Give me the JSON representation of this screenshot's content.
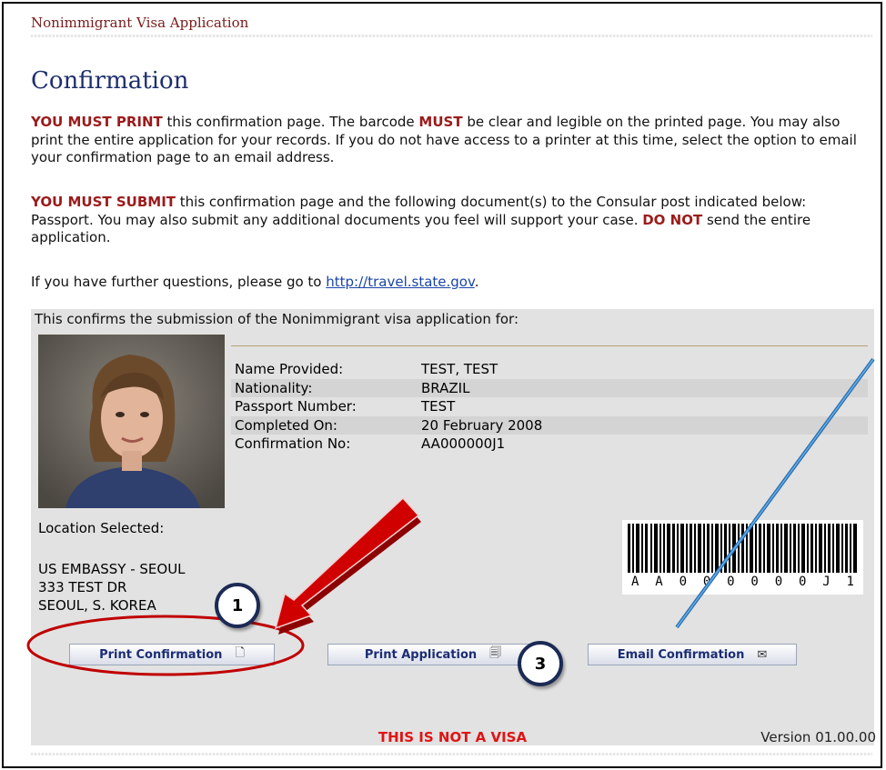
{
  "header": {
    "app_title": "Nonimmigrant Visa Application"
  },
  "page_title": "Confirmation",
  "instructions": {
    "p1": {
      "strong": "YOU MUST PRINT",
      "t1": " this confirmation page. The barcode ",
      "must": "MUST",
      "t2": " be clear and legible on the printed page. You may also print the entire application for your records. If you do not have access to a printer at this time, select the option to email your confirmation page to an email address."
    },
    "p2": {
      "strong": "YOU MUST SUBMIT",
      "t1": " this confirmation page and the following document(s) to the Consular post indicated below: Passport. You may also submit any additional documents you feel will support your case. ",
      "donot": "DO NOT",
      "t2": " send the entire application."
    },
    "p3": {
      "t1": "If you have further questions, please go to ",
      "link": "http://travel.state.gov",
      "t2": "."
    }
  },
  "confirmation_panel": {
    "heading": "This confirms the submission of the Nonimmigrant visa application for:",
    "rows": [
      {
        "label": "Name Provided:",
        "value": "TEST, TEST"
      },
      {
        "label": "Nationality:",
        "value": "BRAZIL"
      },
      {
        "label": "Passport Number:",
        "value": "TEST"
      },
      {
        "label": "Completed On:",
        "value": "20 February 2008"
      },
      {
        "label": "Confirmation No:",
        "value": "AA000000J1"
      }
    ],
    "location_label": "Location Selected:",
    "location_lines": [
      "US EMBASSY - SEOUL",
      "333 TEST DR",
      "SEOUL, S. KOREA"
    ],
    "barcode_text": [
      "A",
      "A",
      "0",
      "0",
      "0",
      "0",
      "0",
      "0",
      "J",
      "1"
    ]
  },
  "buttons": {
    "print_confirmation": "Print Confirmation",
    "print_application": "Print Application",
    "email_confirmation": "Email Confirmation"
  },
  "footer": {
    "notice": "THIS IS NOT A VISA",
    "version": "Version 01.00.00"
  },
  "annotations": {
    "badge1": "1",
    "badge3": "3"
  },
  "colors": {
    "accent_red": "#9b1b1b",
    "title_blue": "#1e2f6b",
    "arrow_red": "#c00000",
    "arrow_blue": "#1f6fb5"
  }
}
